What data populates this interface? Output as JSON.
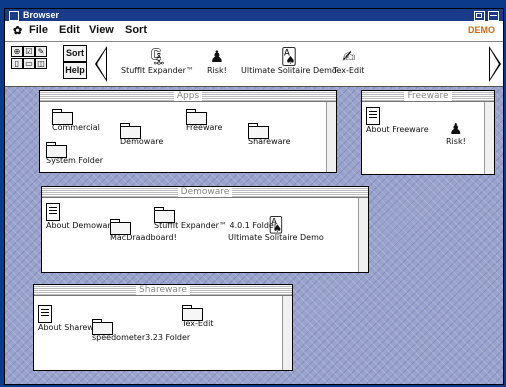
{
  "window": {
    "title": "Browser"
  },
  "menubar": {
    "apple": "✿",
    "file": "File",
    "edit": "Edit",
    "view": "View",
    "sort": "Sort",
    "badge": "DEMO"
  },
  "toolbar": {
    "sort_label": "Sort",
    "help_label": "Help",
    "apps": [
      {
        "label": "StuffIt Expander™",
        "icon": "stuffit-icon"
      },
      {
        "label": "Risk!",
        "icon": "risk-icon"
      },
      {
        "label": "Ultimate Solitaire Demo",
        "icon": "solitaire-icon"
      },
      {
        "label": "Tex-Edit",
        "icon": "texedit-icon"
      }
    ]
  },
  "panels": {
    "apps": {
      "title": "Apps",
      "items": [
        {
          "label": "Commercial"
        },
        {
          "label": "Freeware"
        },
        {
          "label": "Demoware"
        },
        {
          "label": "Shareware"
        },
        {
          "label": "System Folder"
        }
      ]
    },
    "freeware": {
      "title": "Freeware",
      "items": [
        {
          "label": "About Freeware"
        },
        {
          "label": "Risk!"
        }
      ]
    },
    "demoware": {
      "title": "Demoware",
      "items": [
        {
          "label": "About Demoware"
        },
        {
          "label": "MacDraadboard!"
        },
        {
          "label": "StuffIt Expander™ 4.0.1 Folder"
        },
        {
          "label": "Ultimate Solitaire Demo"
        }
      ]
    },
    "shareware": {
      "title": "Shareware",
      "items": [
        {
          "label": "About Shareware"
        },
        {
          "label": "speedometer3.23 Folder"
        },
        {
          "label": "Tex-Edit"
        }
      ]
    }
  },
  "colors": {
    "title_bar": "#1a3a8a",
    "badge": "#d4690a",
    "desktop": "#9aa3cb"
  }
}
